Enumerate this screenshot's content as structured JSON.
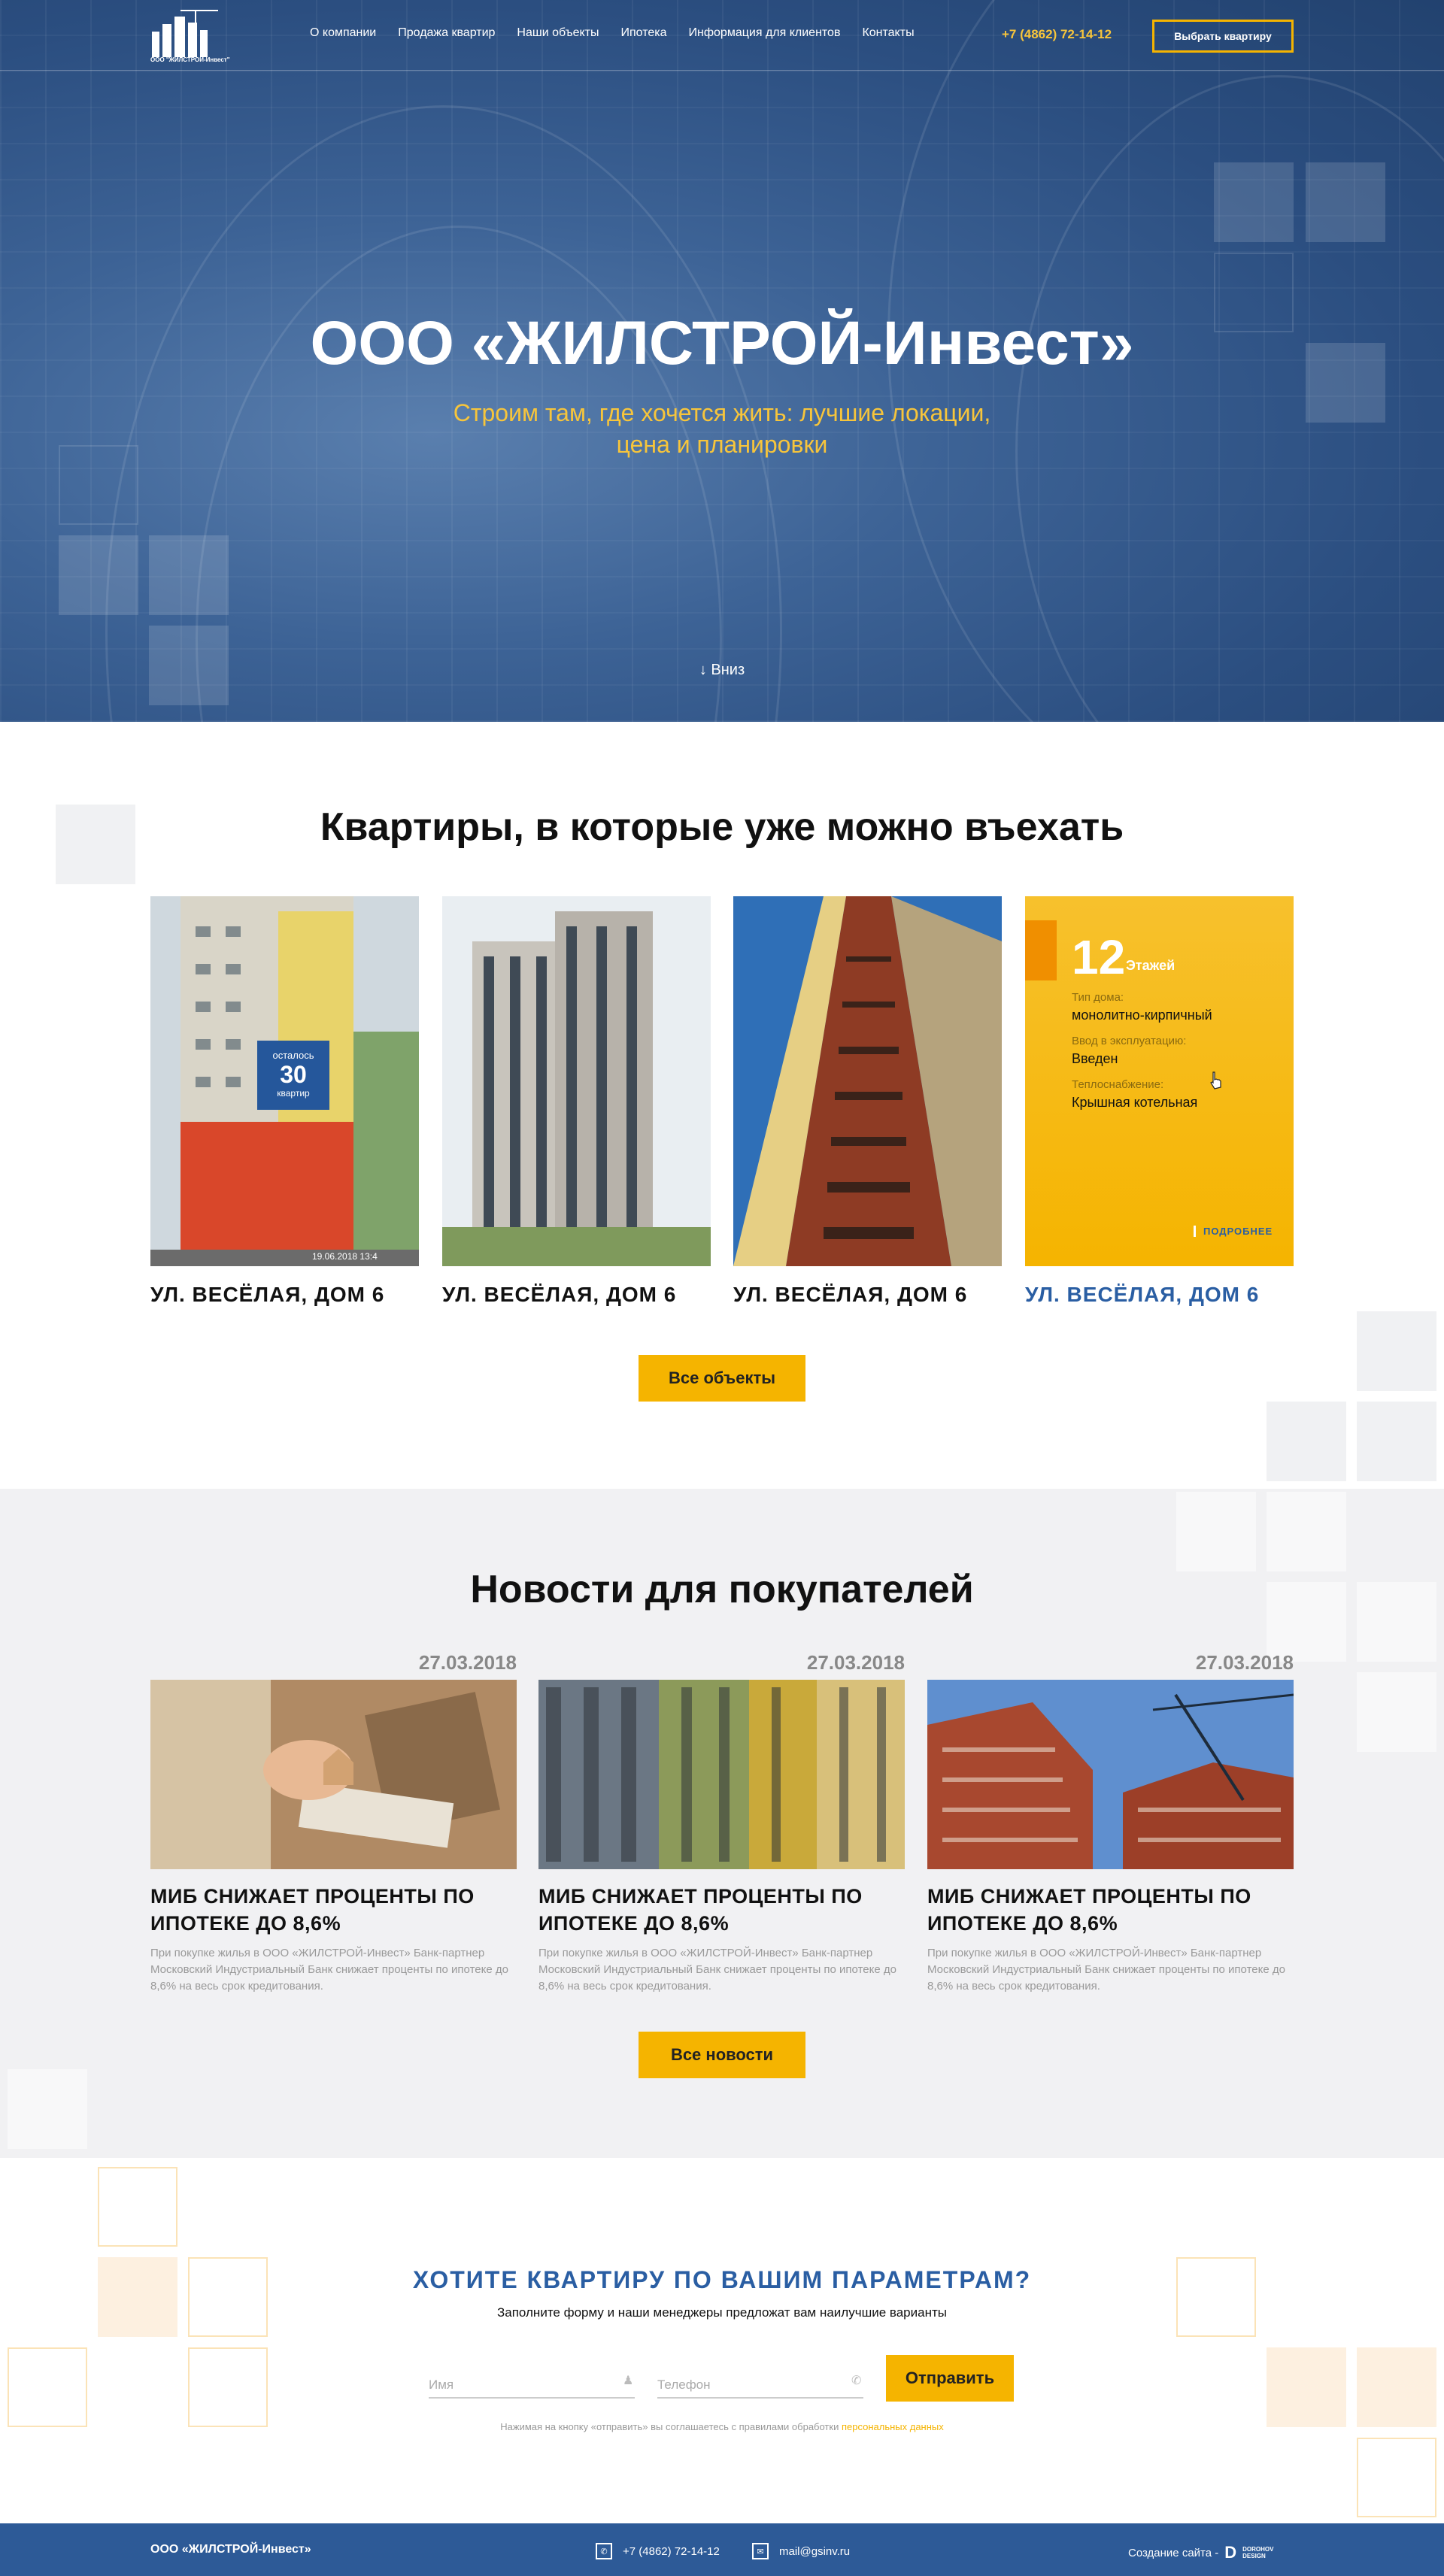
{
  "header": {
    "logo_text": "ООО \"ЖИЛСТРОЙ-Инвест\"",
    "nav": [
      "О компании",
      "Продажа квартир",
      "Наши объекты",
      "Ипотека",
      "Информация для клиентов",
      "Контакты"
    ],
    "phone": "+7 (4862) 72-14-12",
    "cta_label": "Выбрать квартиру"
  },
  "hero": {
    "title": "ООО «ЖИЛСТРОЙ-Инвест»",
    "subtitle_line1": "Строим там, где хочется жить: лучшие локации,",
    "subtitle_line2": "цена и планировки",
    "down_label": "↓ Вниз"
  },
  "apartments": {
    "title": "Квартиры, в которые уже можно въехать",
    "cards": [
      {
        "caption": "УЛ. ВЕСЁЛАЯ, ДОМ 6"
      },
      {
        "caption": "УЛ. ВЕСЁЛАЯ, ДОМ 6"
      },
      {
        "caption": "УЛ. ВЕСЁЛАЯ, ДОМ 6"
      },
      {
        "caption": "УЛ. ВЕСЁЛАЯ, ДОМ 6"
      }
    ],
    "remaining": {
      "prefix": "осталось",
      "count": "30",
      "suffix": "квартир"
    },
    "photo_stamp": "19.06.2018  13:4",
    "detail": {
      "floors": "12",
      "floors_label": "Этажей",
      "type_label": "Тип дома:",
      "type_value": "монолитно-кирпичный",
      "commission_label": "Ввод в эксплуатацию:",
      "commission_value": "Введен",
      "heating_label": "Теплоснабжение:",
      "heating_value": "Крышная котельная",
      "more": "ПОДРОБНЕЕ"
    },
    "all_button": "Все объекты"
  },
  "news": {
    "title": "Новости для покупателей",
    "items": [
      {
        "date": "27.03.2018",
        "title_line1": "МИБ СНИЖАЕТ ПРОЦЕНТЫ ПО",
        "title_line2": "ИПОТЕКЕ ДО 8,6%",
        "text": "При покупке жилья в ООО «ЖИЛСТРОЙ-Инвест» Банк-партнер Московский Индустриальный Банк снижает проценты по ипотеке до 8,6% на весь срок кредитования."
      },
      {
        "date": "27.03.2018",
        "title_line1": "МИБ СНИЖАЕТ ПРОЦЕНТЫ ПО",
        "title_line2": "ИПОТЕКЕ ДО 8,6%",
        "text": "При покупке жилья в ООО «ЖИЛСТРОЙ-Инвест» Банк-партнер Московский Индустриальный Банк снижает проценты по ипотеке до 8,6% на весь срок кредитования."
      },
      {
        "date": "27.03.2018",
        "title_line1": "МИБ СНИЖАЕТ ПРОЦЕНТЫ ПО",
        "title_line2": "ИПОТЕКЕ ДО 8,6%",
        "text": "При покупке жилья в ООО «ЖИЛСТРОЙ-Инвест» Банк-партнер Московский Индустриальный Банк снижает проценты по ипотеке до 8,6% на весь срок кредитования."
      }
    ],
    "all_button": "Все новости"
  },
  "form": {
    "title": "ХОТИТЕ КВАРТИРУ ПО ВАШИМ ПАРАМЕТРАМ?",
    "subtitle": "Заполните форму и наши менеджеры предложат вам наилучшие варианты",
    "name_placeholder": "Имя",
    "phone_placeholder": "Телефон",
    "submit": "Отправить",
    "consent_text": "Нажимая на кнопку «отправить» вы соглашаетесь с правилами обработки ",
    "consent_link": "персональных данных"
  },
  "footer": {
    "company": "ООО «ЖИЛСТРОЙ-Инвест»",
    "phone": "+7 (4862) 72-14-12",
    "email": "mail@gsinv.ru",
    "credit": "Создание сайта -",
    "designer_line1": "DOROHOV",
    "designer_line2": "DESIGN"
  },
  "colors": {
    "accent": "#f5b400",
    "brand_blue": "#2d5a97",
    "light_bg": "#f1f1f3"
  }
}
